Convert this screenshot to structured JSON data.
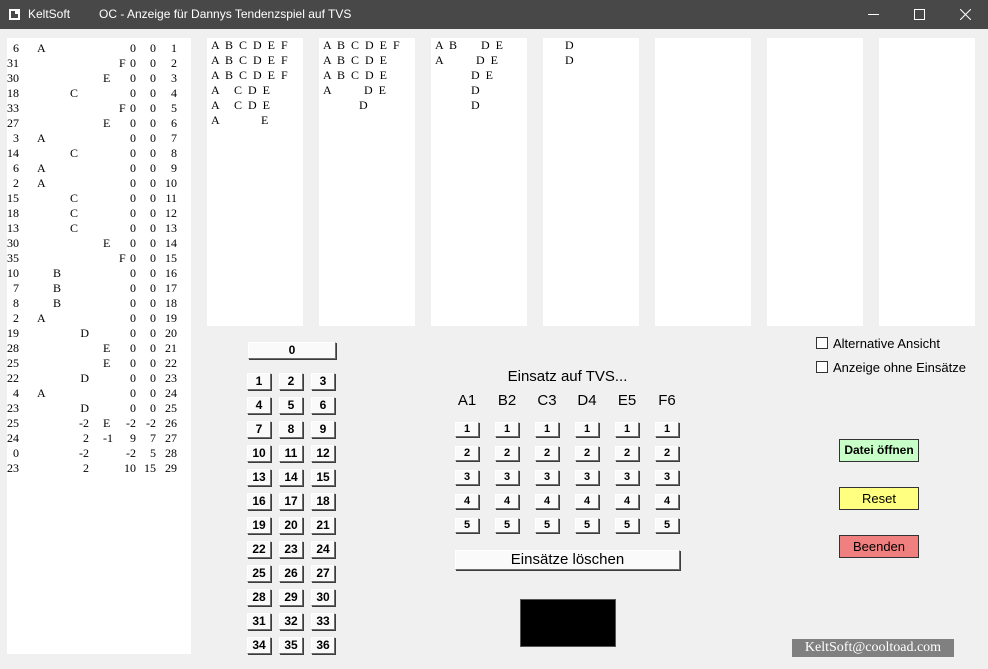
{
  "window": {
    "app_name": "KeltSoft",
    "title": "OC - Anzeige für Dannys Tendenzspiel auf TVS"
  },
  "history": [
    [
      "6",
      "A",
      "",
      "",
      "",
      "",
      "",
      "0",
      "0",
      "1"
    ],
    [
      "31",
      "",
      "",
      "",
      "",
      "",
      "F",
      "0",
      "0",
      "2"
    ],
    [
      "30",
      "",
      "",
      "",
      "",
      "E",
      "",
      "0",
      "0",
      "3"
    ],
    [
      "18",
      "",
      "",
      "C",
      "",
      "",
      "",
      "0",
      "0",
      "4"
    ],
    [
      "33",
      "",
      "",
      "",
      "",
      "",
      "F",
      "0",
      "0",
      "5"
    ],
    [
      "27",
      "",
      "",
      "",
      "",
      "E",
      "",
      "0",
      "0",
      "6"
    ],
    [
      "3",
      "A",
      "",
      "",
      "",
      "",
      "",
      "0",
      "0",
      "7"
    ],
    [
      "14",
      "",
      "",
      "C",
      "",
      "",
      "",
      "0",
      "0",
      "8"
    ],
    [
      "6",
      "A",
      "",
      "",
      "",
      "",
      "",
      "0",
      "0",
      "9"
    ],
    [
      "2",
      "A",
      "",
      "",
      "",
      "",
      "",
      "0",
      "0",
      "10"
    ],
    [
      "15",
      "",
      "",
      "C",
      "",
      "",
      "",
      "0",
      "0",
      "11"
    ],
    [
      "18",
      "",
      "",
      "C",
      "",
      "",
      "",
      "0",
      "0",
      "12"
    ],
    [
      "13",
      "",
      "",
      "C",
      "",
      "",
      "",
      "0",
      "0",
      "13"
    ],
    [
      "30",
      "",
      "",
      "",
      "",
      "E",
      "",
      "0",
      "0",
      "14"
    ],
    [
      "35",
      "",
      "",
      "",
      "",
      "",
      "F",
      "0",
      "0",
      "15"
    ],
    [
      "10",
      "",
      "B",
      "",
      "",
      "",
      "",
      "0",
      "0",
      "16"
    ],
    [
      "7",
      "",
      "B",
      "",
      "",
      "",
      "",
      "0",
      "0",
      "17"
    ],
    [
      "8",
      "",
      "B",
      "",
      "",
      "",
      "",
      "0",
      "0",
      "18"
    ],
    [
      "2",
      "A",
      "",
      "",
      "",
      "",
      "",
      "0",
      "0",
      "19"
    ],
    [
      "19",
      "",
      "",
      "",
      "D",
      "",
      "",
      "0",
      "0",
      "20"
    ],
    [
      "28",
      "",
      "",
      "",
      "",
      "E",
      "",
      "0",
      "0",
      "21"
    ],
    [
      "25",
      "",
      "",
      "",
      "",
      "E",
      "",
      "0",
      "0",
      "22"
    ],
    [
      "22",
      "",
      "",
      "",
      "D",
      "",
      "",
      "0",
      "0",
      "23"
    ],
    [
      "4",
      "A",
      "",
      "",
      "",
      "",
      "",
      "0",
      "0",
      "24"
    ],
    [
      "23",
      "",
      "",
      "",
      "D",
      "",
      "",
      "0",
      "0",
      "25"
    ],
    [
      "25",
      "",
      "",
      "",
      "-2",
      "E",
      "",
      "-2",
      "-2",
      "26"
    ],
    [
      "24",
      "",
      "",
      "",
      "2",
      "-1",
      "",
      "9",
      "7",
      "27"
    ],
    [
      "0",
      "",
      "",
      "",
      "-2",
      "",
      "",
      "-2",
      "5",
      "28"
    ],
    [
      "23",
      "",
      "",
      "",
      "2",
      "",
      "",
      "10",
      "15",
      "29"
    ]
  ],
  "columns": [
    [
      "A  B  C  D  E  F",
      "A  B  C  D  E  F",
      "A  B  C  D  E  F",
      "A     C  D  E",
      "A     C  D  E",
      "A              E"
    ],
    [
      "A  B  C  D  E  F",
      "A  B  C  D  E",
      "A  B  C  D  E",
      "A           D  E",
      "            D"
    ],
    [
      "A  B        D  E",
      "A           D  E",
      "            D  E",
      "            D",
      "            D"
    ],
    [
      "      D",
      "      D"
    ],
    [],
    [],
    []
  ],
  "zero_label": "0",
  "numbers": [
    "1",
    "2",
    "3",
    "4",
    "5",
    "6",
    "7",
    "8",
    "9",
    "10",
    "11",
    "12",
    "13",
    "14",
    "15",
    "16",
    "17",
    "18",
    "19",
    "20",
    "21",
    "22",
    "23",
    "24",
    "25",
    "26",
    "27",
    "28",
    "29",
    "30",
    "31",
    "32",
    "33",
    "34",
    "35",
    "36"
  ],
  "bet": {
    "title": "Einsatz auf TVS...",
    "headers": [
      "A1",
      "B2",
      "C3",
      "D4",
      "E5",
      "F6"
    ],
    "values": [
      "1",
      "2",
      "3",
      "4",
      "5"
    ],
    "clear_label": "Einsätze löschen"
  },
  "options": {
    "alt_view": "Alternative Ansicht",
    "no_bets": "Anzeige ohne Einsätze"
  },
  "actions": {
    "open_file": "Datei öffnen",
    "reset": "Reset",
    "quit": "Beenden"
  },
  "colors": {
    "open_file": "#c8ffc8",
    "reset": "#ffff80",
    "quit": "#f08080",
    "display": "#000000",
    "credit_bg": "#808080"
  },
  "credit": "KeltSoft@cooltoad.com"
}
